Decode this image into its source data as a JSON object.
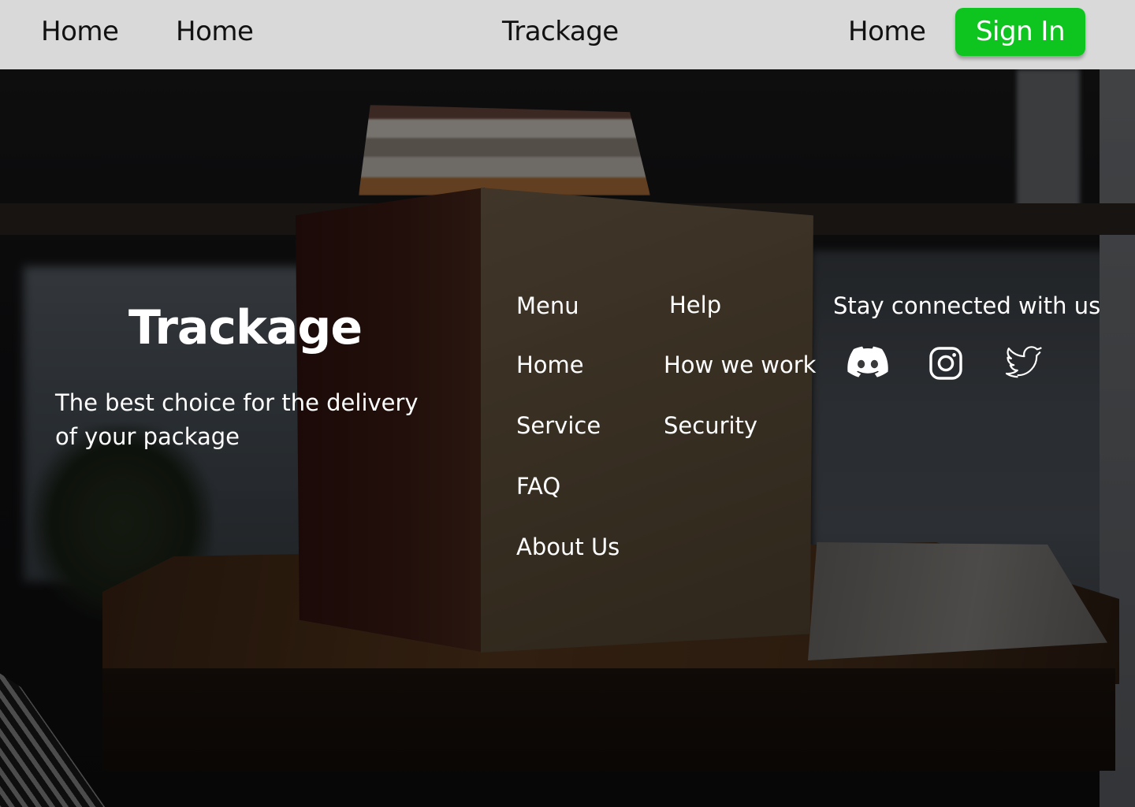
{
  "topbar": {
    "nav_left_1": "Home",
    "nav_left_2": "Home",
    "brand": "Trackage",
    "nav_right": "Home",
    "signin_label": "Sign In",
    "signin_color": "#0ec41e",
    "bar_color": "#d9d9d9"
  },
  "hero": {
    "title": "Trackage",
    "tagline": "The best choice for the delivery of your package"
  },
  "menu": {
    "heading": "Menu",
    "items": [
      "Home",
      "Service",
      "FAQ",
      "About Us"
    ]
  },
  "help": {
    "heading": "Help",
    "items": [
      "How we work",
      "Security"
    ]
  },
  "social": {
    "heading": "Stay connected with us",
    "icons": [
      "discord-icon",
      "instagram-icon",
      "twitter-icon"
    ]
  }
}
